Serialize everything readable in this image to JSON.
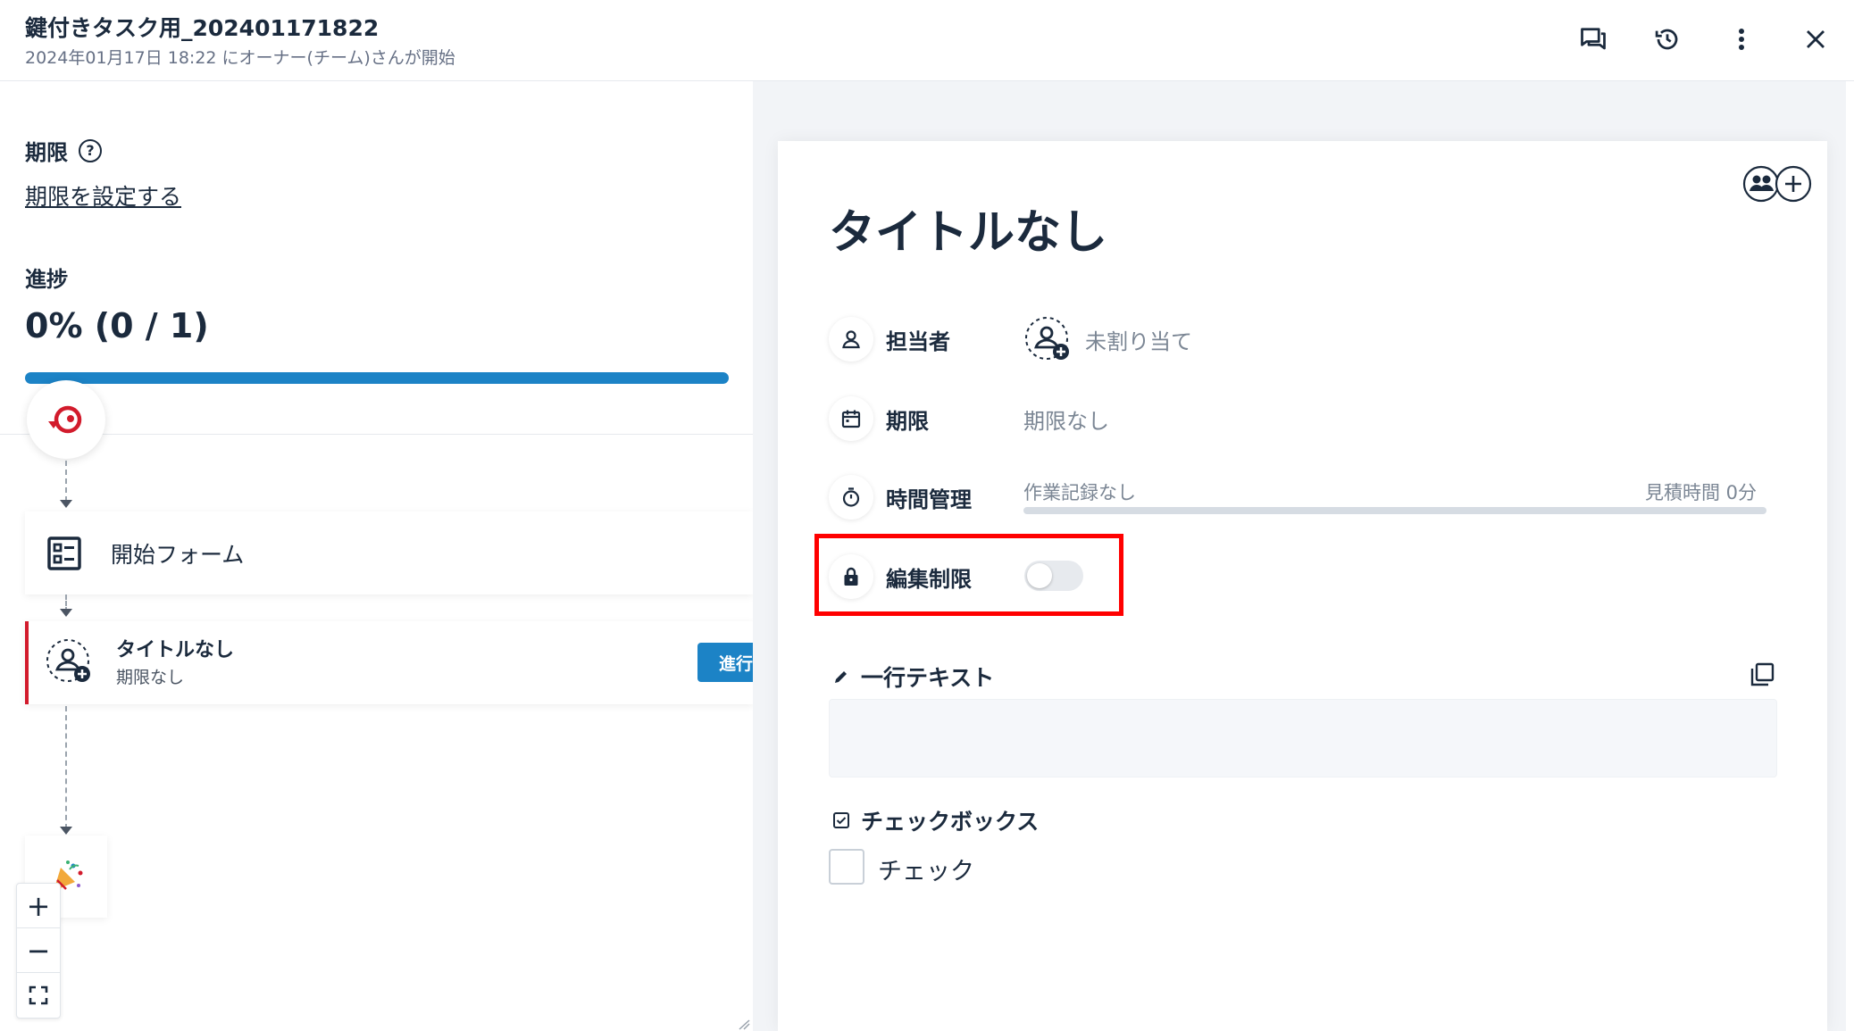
{
  "header": {
    "title": "鍵付きタスク用_202401171822",
    "subtitle": "2024年01月17日 18:22 にオーナー(チーム)さんが開始",
    "icons": [
      "comments-icon",
      "history-icon",
      "more-vert-icon",
      "close-icon"
    ]
  },
  "left_panel": {
    "deadline_label": "期限",
    "deadline_link": "期限を設定する",
    "progress_label": "進捗",
    "progress_value": "0% (0 / 1)",
    "progress_fraction": 0,
    "flow": {
      "start_form_label": "開始フォーム",
      "task_title": "タイトルなし",
      "task_subtitle": "期限なし",
      "task_button": "進行"
    },
    "zoom": {
      "zoom_in": "+",
      "zoom_out": "−"
    }
  },
  "task_card": {
    "title": "タイトルなし",
    "assignee_label": "担当者",
    "assignee_value": "未割り当て",
    "deadline_label": "期限",
    "deadline_value": "期限なし",
    "time_label": "時間管理",
    "time_record": "作業記録なし",
    "time_estimate": "見積時間 0分",
    "edit_lock_label": "編集制限",
    "edit_lock_on": false,
    "field_text_label": "一行テキスト",
    "field_text_value": "",
    "field_checkbox_label": "チェックボックス",
    "checkbox_option": "チェック",
    "checkbox_checked": false
  },
  "colors": {
    "accent_blue": "#1c83c6",
    "task_marker_red": "#d21b2c",
    "highlight_red": "#ff0000",
    "text_dark": "#1b2a3d",
    "text_muted": "#7b8694"
  }
}
